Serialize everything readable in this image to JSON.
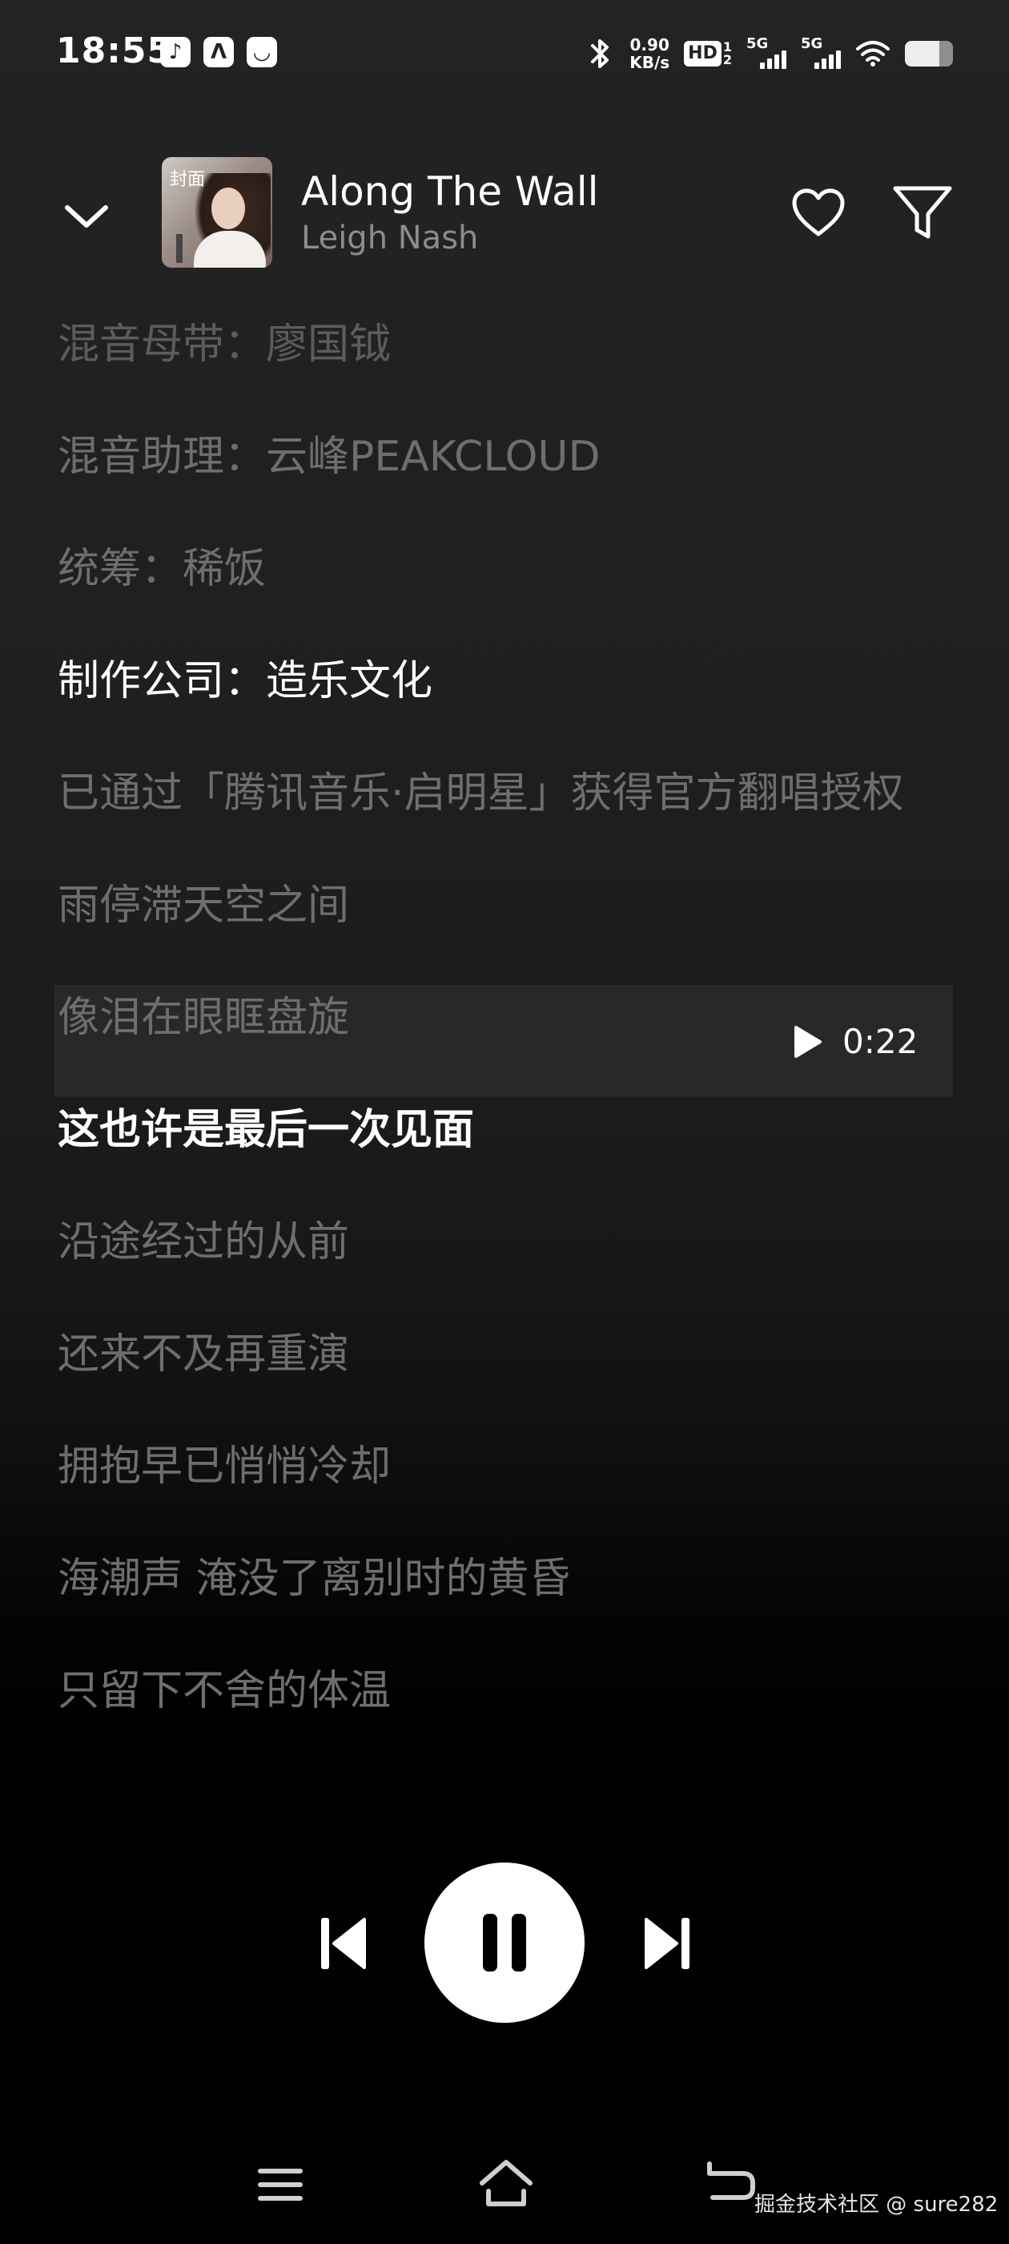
{
  "status_bar": {
    "time": "18:55",
    "app_icons": [
      "douyin-icon",
      "a-logo-icon",
      "notification-app-icon"
    ],
    "net_speed_value": "0.90",
    "net_speed_unit": "KB/s",
    "hd_label": "HD",
    "hd_sub_top": "1",
    "hd_sub_bottom": "2",
    "signal_1_label": "5G",
    "signal_2_label": "5G",
    "battery_level": 0.72
  },
  "header": {
    "cover_text": "封面",
    "song_title": "Along The Wall",
    "artist": "Leigh Nash"
  },
  "lyrics": {
    "lines": [
      "混音母带：廖国钺",
      "混音助理：云峰PEAKCLOUD",
      "统筹：稀饭",
      "制作公司：造乐文化",
      "已通过「腾讯音乐·启明星」获得官方翻唱授权",
      "雨停滞天空之间",
      "像泪在眼眶盘旋",
      "这也许是最后一次见面",
      "沿途经过的从前",
      "还来不及再重演",
      "拥抱早已悄悄冷却",
      "海潮声 淹没了离别时的黄昏",
      "只留下不舍的体温"
    ],
    "seek_time": "0:22"
  },
  "watermark": "掘金技术社区 @ sure282",
  "colors": {
    "background_top": "#232323",
    "background_bottom": "#000000",
    "lyric_inactive": "#6e6e6e",
    "lyric_active": "#ffffff",
    "artist": "#8c8c8c"
  }
}
